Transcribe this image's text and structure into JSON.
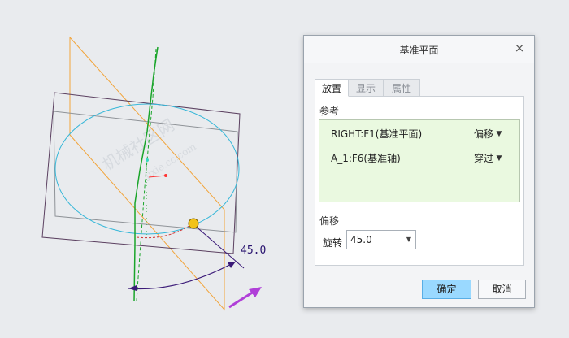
{
  "viewport": {
    "watermark_main": "机械社区网",
    "watermark_sub": "jixie.cc.com",
    "dimension_label": "45.0"
  },
  "dialog": {
    "title": "基准平面",
    "close_glyph": "×",
    "tabs": [
      {
        "label": "放置",
        "active": true
      },
      {
        "label": "显示",
        "active": false
      },
      {
        "label": "属性",
        "active": false
      }
    ],
    "references_label": "参考",
    "references": [
      {
        "name": "RIGHT:F1(基准平面)",
        "type": "偏移"
      },
      {
        "name": "A_1:F6(基准轴)",
        "type": "穿过"
      }
    ],
    "offset_label": "偏移",
    "rotation_label": "旋转",
    "rotation_value": "45.0",
    "ok_label": "确定",
    "cancel_label": "取消"
  },
  "colors": {
    "ref_background": "#eaf9e0",
    "primary_button": "#9ad9ff",
    "plane_orange": "#f2a43a",
    "circle_cyan": "#36b7d8",
    "axis_green": "#1aa52a",
    "dimension_purple": "#3b1a78",
    "arrow_magenta": "#b03fd8"
  }
}
